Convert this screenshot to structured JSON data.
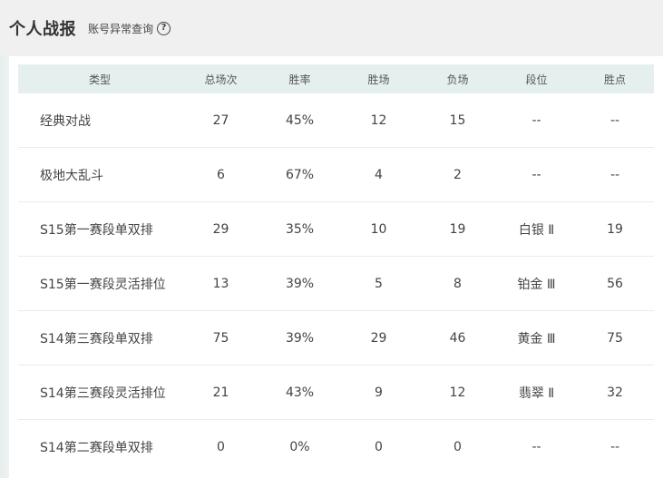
{
  "header": {
    "title": "个人战报",
    "query_link": "账号异常查询",
    "help_glyph": "?"
  },
  "table": {
    "columns": {
      "type": "类型",
      "total": "总场次",
      "rate": "胜率",
      "wins": "胜场",
      "losses": "负场",
      "rank": "段位",
      "points": "胜点"
    },
    "rows": [
      {
        "type": "经典对战",
        "total": "27",
        "rate": "45%",
        "wins": "12",
        "losses": "15",
        "rank": "--",
        "points": "--"
      },
      {
        "type": "极地大乱斗",
        "total": "6",
        "rate": "67%",
        "wins": "4",
        "losses": "2",
        "rank": "--",
        "points": "--"
      },
      {
        "type": "S15第一赛段单双排",
        "total": "29",
        "rate": "35%",
        "wins": "10",
        "losses": "19",
        "rank": "白银 Ⅱ",
        "points": "19"
      },
      {
        "type": "S15第一赛段灵活排位",
        "total": "13",
        "rate": "39%",
        "wins": "5",
        "losses": "8",
        "rank": "铂金 Ⅲ",
        "points": "56"
      },
      {
        "type": "S14第三赛段单双排",
        "total": "75",
        "rate": "39%",
        "wins": "29",
        "losses": "46",
        "rank": "黄金 Ⅲ",
        "points": "75"
      },
      {
        "type": "S14第三赛段灵活排位",
        "total": "21",
        "rate": "43%",
        "wins": "9",
        "losses": "12",
        "rank": "翡翠 Ⅱ",
        "points": "32"
      },
      {
        "type": "S14第二赛段单双排",
        "total": "0",
        "rate": "0%",
        "wins": "0",
        "losses": "0",
        "rank": "--",
        "points": "--"
      }
    ]
  },
  "colors": {
    "header_bg": "#e5f0ee",
    "page_bg": "#f0f0f0",
    "panel_bg": "#ffffff"
  }
}
